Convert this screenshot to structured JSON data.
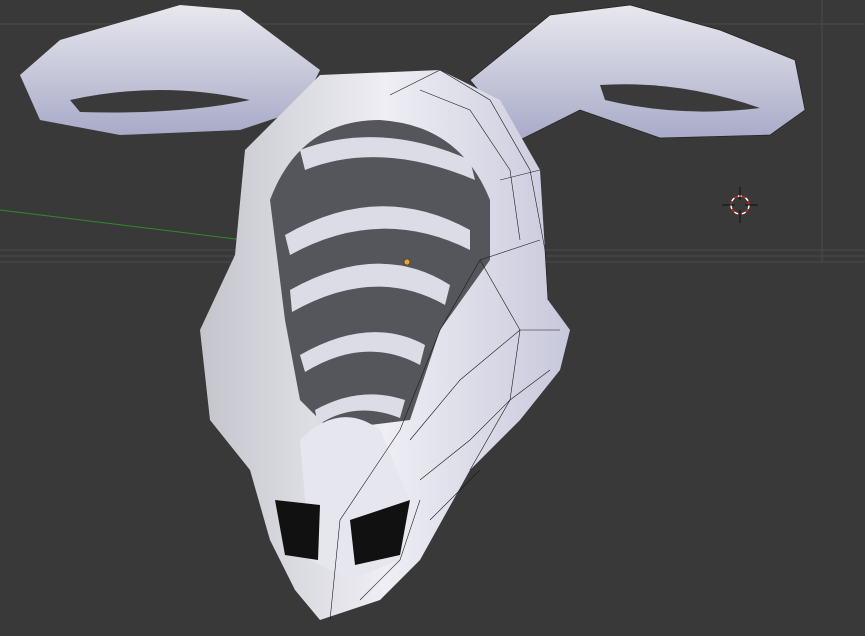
{
  "viewport": {
    "background_color": "#393939",
    "grid_color": "#4a4a4a",
    "x_axis_color": "#8a2a2a",
    "y_axis_color": "#2f8a2f",
    "mesh_color": "#d8d8e6",
    "mesh_dark_color": "#55565c",
    "wire_color": "#1a1a1a",
    "origin_color": "#f0a030"
  },
  "icons": {
    "cursor": "3d-cursor-icon",
    "origin": "object-origin-icon"
  }
}
